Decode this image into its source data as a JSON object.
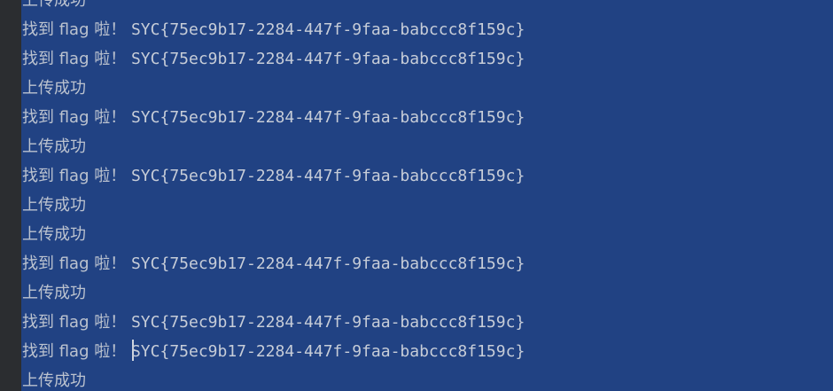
{
  "console": {
    "lines": [
      {
        "type": "success",
        "text": "上传成功"
      },
      {
        "type": "flag",
        "prefix": "找到 flag 啦！ ",
        "flag": "SYC{75ec9b17-2284-447f-9faa-babccc8f159c}"
      },
      {
        "type": "flag",
        "prefix": "找到 flag 啦！ ",
        "flag": "SYC{75ec9b17-2284-447f-9faa-babccc8f159c}"
      },
      {
        "type": "success",
        "text": "上传成功"
      },
      {
        "type": "flag",
        "prefix": "找到 flag 啦！ ",
        "flag": "SYC{75ec9b17-2284-447f-9faa-babccc8f159c}"
      },
      {
        "type": "success",
        "text": "上传成功"
      },
      {
        "type": "flag",
        "prefix": "找到 flag 啦！ ",
        "flag": "SYC{75ec9b17-2284-447f-9faa-babccc8f159c}"
      },
      {
        "type": "success",
        "text": "上传成功"
      },
      {
        "type": "success",
        "text": "上传成功"
      },
      {
        "type": "flag",
        "prefix": "找到 flag 啦！ ",
        "flag": "SYC{75ec9b17-2284-447f-9faa-babccc8f159c}"
      },
      {
        "type": "success",
        "text": "上传成功"
      },
      {
        "type": "flag",
        "prefix": "找到 flag 啦！ ",
        "flag": "SYC{75ec9b17-2284-447f-9faa-babccc8f159c}"
      },
      {
        "type": "flag",
        "prefix": "找到 flag 啦！ ",
        "flag": "SYC{75ec9b17-2284-447f-9faa-babccc8f159c}",
        "caret": true
      },
      {
        "type": "success",
        "text": "上传成功"
      }
    ]
  },
  "colors": {
    "selection": "#214283",
    "background": "#2b2d30",
    "text": "#c7cdd8"
  }
}
